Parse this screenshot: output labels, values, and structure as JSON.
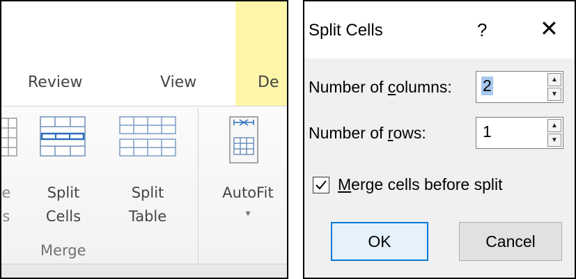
{
  "ribbon": {
    "tabs": {
      "review": "Review",
      "view": "View",
      "design": "De"
    },
    "partial_button": {
      "line1": "e",
      "line2": "s"
    },
    "split_cells": {
      "line1": "Split",
      "line2": "Cells"
    },
    "split_table": {
      "line1": "Split",
      "line2": "Table"
    },
    "autofit": {
      "label": "AutoFit",
      "arrow": "▾"
    },
    "group_label": "Merge",
    "colors": {
      "design_tab_bg": "#fdf6a9",
      "icon_blue": "#2a6ebb"
    }
  },
  "dialog": {
    "title": "Split Cells",
    "help_symbol": "?",
    "close_symbol": "✕",
    "columns": {
      "label_pre": "Number of ",
      "label_ul": "c",
      "label_post": "olumns:",
      "value": "2"
    },
    "rows": {
      "label_pre": "Number of ",
      "label_ul": "r",
      "label_post": "ows:",
      "value": "1"
    },
    "merge_checkbox": {
      "checked": true,
      "label_ul": "M",
      "label_post": "erge cells before split"
    },
    "ok_label": "OK",
    "cancel_label": "Cancel",
    "colors": {
      "default_button_border": "#0078d7",
      "selection_bg": "#a8c8ef"
    }
  }
}
